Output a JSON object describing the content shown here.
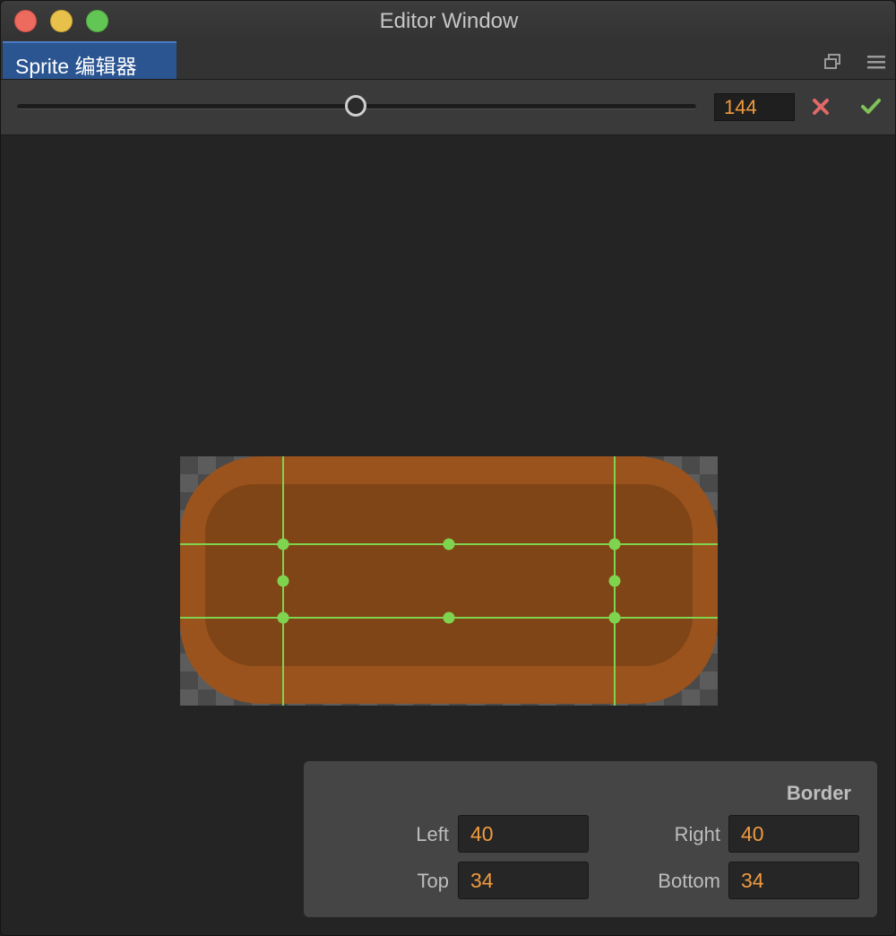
{
  "window": {
    "title": "Editor Window"
  },
  "tabs": [
    {
      "label": "Sprite 编辑器",
      "active": true
    }
  ],
  "icons": {
    "popout": "popout-window-icon",
    "menu": "hamburger-menu-icon",
    "cancel": "close-x-icon",
    "confirm": "checkmark-icon"
  },
  "toolbar": {
    "zoom_value": "144",
    "zoom_slider_fraction": 0.5
  },
  "border": {
    "title": "Border",
    "left_label": "Left",
    "left_value": "40",
    "right_label": "Right",
    "right_value": "40",
    "top_label": "Top",
    "top_value": "34",
    "bottom_label": "Bottom",
    "bottom_value": "34"
  },
  "colors": {
    "accent_tab": "#2b5591",
    "value_text": "#f09a3e",
    "guide_line": "#7fd44f",
    "sprite_outer": "#9a531d",
    "sprite_inner": "#804516",
    "cancel": "#e06868",
    "confirm": "#7fc257"
  }
}
